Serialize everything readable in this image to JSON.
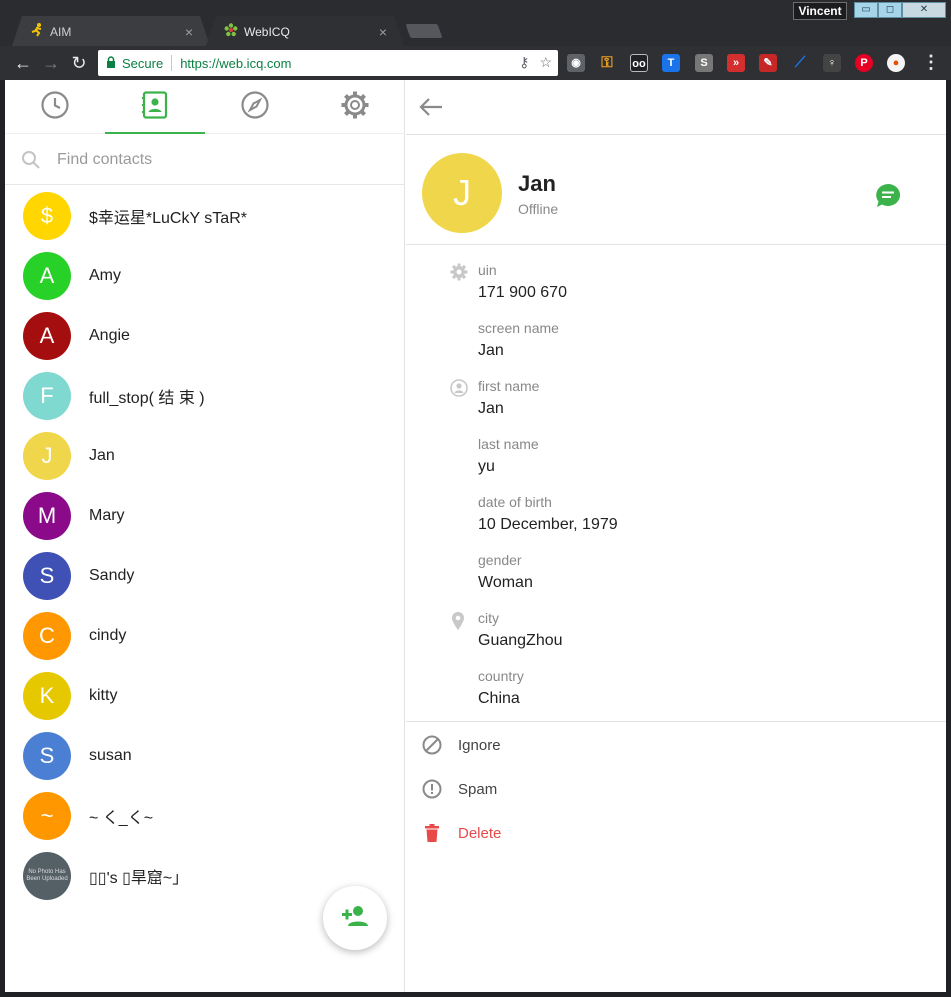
{
  "browser": {
    "tabs": [
      {
        "title": "AIM",
        "close": "×",
        "icon": "aim-running-man-icon",
        "active": false
      },
      {
        "title": "WebICQ",
        "close": "×",
        "icon": "icq-flower-icon",
        "active": true
      }
    ],
    "user": "Vincent",
    "window_controls": {
      "minimize": "▭",
      "restore": "◻",
      "close": "✕"
    },
    "address": {
      "secure_label": "Secure",
      "url": "https://web.icq.com"
    },
    "extensions": [
      "camera-icon",
      "key-icon",
      "bluetooth-icon",
      "translate-icon",
      "s-icon",
      "fast-forward-icon",
      "pencil-icon",
      "feather-icon",
      "lightbulb-icon",
      "pinterest-icon",
      "pill-icon"
    ]
  },
  "sidebar": {
    "tabs": [
      {
        "name": "recent",
        "icon": "clock-icon",
        "active": false
      },
      {
        "name": "contacts",
        "icon": "contacts-book-icon",
        "active": true
      },
      {
        "name": "explore",
        "icon": "compass-icon",
        "active": false
      },
      {
        "name": "settings",
        "icon": "gear-icon",
        "active": false
      }
    ],
    "search_placeholder": "Find contacts",
    "contacts": [
      {
        "initial": "$",
        "name": "$幸运星*LuCkY sTaR*",
        "color": "#ffd600"
      },
      {
        "initial": "A",
        "name": "Amy",
        "color": "#27d127"
      },
      {
        "initial": "A",
        "name": "Angie",
        "color": "#a50e0e"
      },
      {
        "initial": "F",
        "name": "full_stop( 结 束 )",
        "color": "#7fd9d0"
      },
      {
        "initial": "J",
        "name": "Jan",
        "color": "#f0d64a"
      },
      {
        "initial": "M",
        "name": "Mary",
        "color": "#8a0a8a"
      },
      {
        "initial": "S",
        "name": "Sandy",
        "color": "#3f51b5"
      },
      {
        "initial": "C",
        "name": "cindy",
        "color": "#ff9800"
      },
      {
        "initial": "K",
        "name": "kitty",
        "color": "#e6c800"
      },
      {
        "initial": "S",
        "name": "susan",
        "color": "#4a7fd4"
      },
      {
        "initial": "~",
        "name": "~ く_く~",
        "color": "#ff9800"
      },
      {
        "initial": "No Photo Has Been Uploaded",
        "name": "▯▯'s ▯旱窟~」",
        "color": "#556066",
        "photo": true
      }
    ]
  },
  "profile": {
    "initial": "J",
    "name": "Jan",
    "status": "Offline",
    "fields": [
      {
        "label": "uin",
        "value": "171 900 670",
        "icon": "gear-icon"
      },
      {
        "label": "screen name",
        "value": "Jan"
      },
      {
        "label": "first name",
        "value": "Jan",
        "icon": "person-icon"
      },
      {
        "label": "last name",
        "value": "yu"
      },
      {
        "label": "date of birth",
        "value": "10 December, 1979"
      },
      {
        "label": "gender",
        "value": "Woman"
      },
      {
        "label": "city",
        "value": "GuangZhou",
        "icon": "location-pin-icon"
      },
      {
        "label": "country",
        "value": "China"
      }
    ],
    "actions": {
      "ignore": "Ignore",
      "spam": "Spam",
      "delete": "Delete"
    }
  }
}
